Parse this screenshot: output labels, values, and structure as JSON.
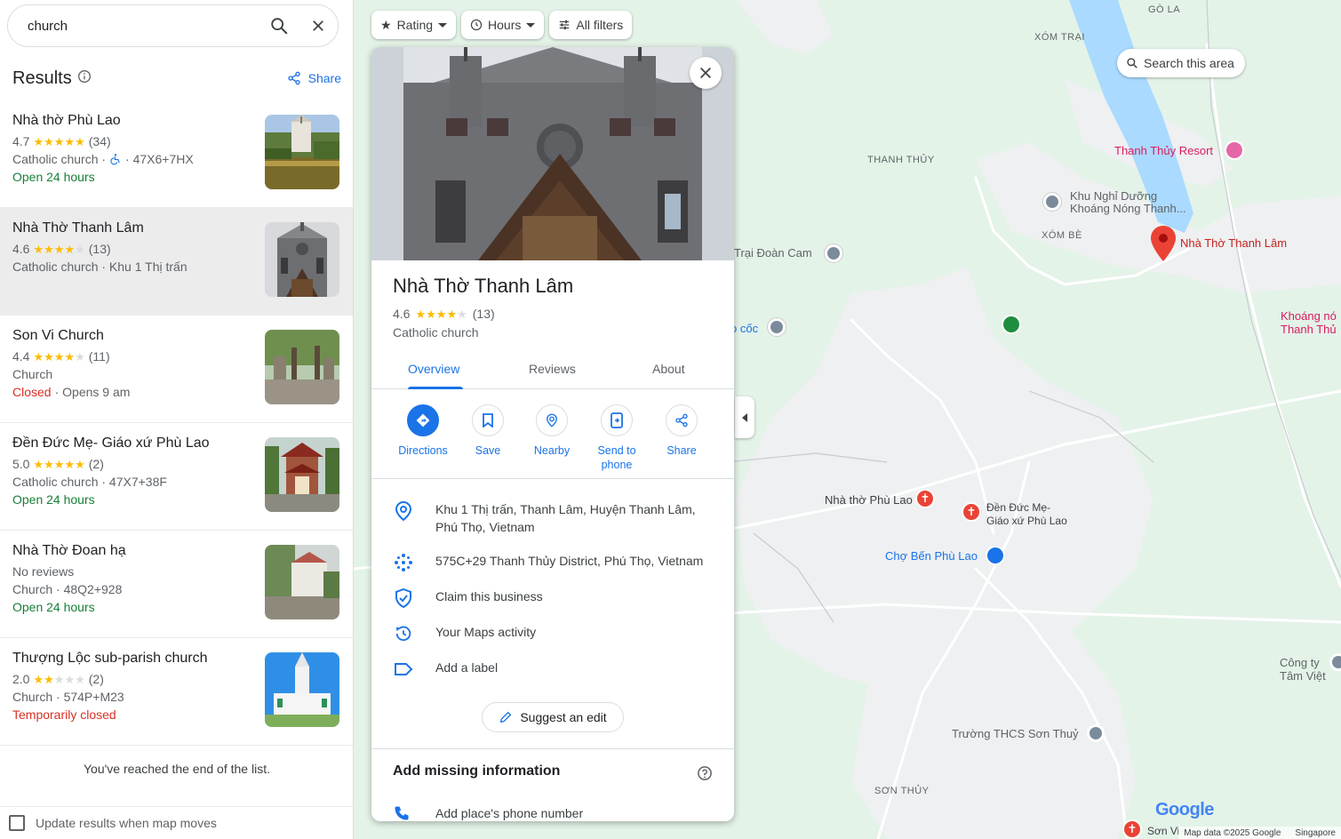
{
  "search": {
    "query": "church"
  },
  "results": {
    "title": "Results",
    "share_label": "Share",
    "items": [
      {
        "name": "Nhà thờ Phù Lao",
        "rating": "4.7",
        "stars": 4.7,
        "reviews": "(34)",
        "line2": "Catholic church · ",
        "line2b": " · 47X6+7HX",
        "status": "Open 24 hours",
        "status_color": "#188038",
        "status_extra": ""
      },
      {
        "name": "Nhà Thờ Thanh Lâm",
        "rating": "4.6",
        "stars": 4.6,
        "reviews": "(13)",
        "line2": "Catholic church · Khu 1 Thị trấn",
        "line2b": "",
        "status": "",
        "status_color": "",
        "status_extra": ""
      },
      {
        "name": "Son Vi Church",
        "rating": "4.4",
        "stars": 4.4,
        "reviews": "(11)",
        "line2": "Church",
        "line2b": "",
        "status": "Closed",
        "status_color": "#d93025",
        "status_extra": " · Opens 9 am"
      },
      {
        "name": "Đền Đức Mẹ- Giáo xứ Phù Lao",
        "rating": "5.0",
        "stars": 5.0,
        "reviews": "(2)",
        "line2": "Catholic church · 47X7+38F",
        "line2b": "",
        "status": "Open 24 hours",
        "status_color": "#188038",
        "status_extra": ""
      },
      {
        "name": "Nhà Thờ Đoan hạ",
        "rating": "No reviews",
        "stars": 0,
        "reviews": "",
        "line2": "Church · 48Q2+928",
        "line2b": "",
        "status": "Open 24 hours",
        "status_color": "#188038",
        "status_extra": ""
      },
      {
        "name": "Thượng Lộc sub-parish church",
        "rating": "2.0",
        "stars": 2.0,
        "reviews": "(2)",
        "line2": "Church · 574P+M23",
        "line2b": "",
        "status": "Temporarily closed",
        "status_color": "#d93025",
        "status_extra": ""
      }
    ],
    "end_text": "You've reached the end of the list.",
    "update_label": "Update results when map moves"
  },
  "filters": {
    "rating": "Rating",
    "hours": "Hours",
    "all": "All filters"
  },
  "map": {
    "search_area": "Search this area",
    "labels": {
      "go_la": "GÒ LA",
      "xom_trai": "XÓM TRẠI",
      "thanh_thuy": "THANH THỦY",
      "xom_be": "XÓM BÈ",
      "son_thuy": "SƠN THỦY"
    },
    "pois": {
      "resort": "Thanh Thủy Resort",
      "khu_nghi_1": "Khu Nghỉ Dưỡng",
      "khu_nghi_2": "Khoáng Nóng Thanh...",
      "thanh_lam": "Nhà Thờ Thanh Lâm",
      "trai_doan": "Trại Đoàn Cam",
      "co_coc": "o cốc",
      "khoang_1": "Khoáng nó",
      "khoang_2": "Thanh Thủ",
      "phu_lao": "Nhà thờ Phù Lao",
      "den_1": "Đền Đức Mẹ-",
      "den_2": "Giáo xứ Phù Lao",
      "cho": "Chợ Bến Phù Lao",
      "cong_ty": "Công ty Tâm Việt",
      "truong": "Trường THCS Sơn Thuỷ",
      "son_vi": "Sơn Vi"
    },
    "attribution": "Map data ©2025 Google",
    "region": "Singapore",
    "logo": "Google"
  },
  "place": {
    "title": "Nhà Thờ Thanh Lâm",
    "rating": "4.6",
    "reviews": "(13)",
    "category": "Catholic church",
    "tabs": [
      "Overview",
      "Reviews",
      "About"
    ],
    "actions": [
      "Directions",
      "Save",
      "Nearby",
      "Send to phone",
      "Share"
    ],
    "address_1": "Khu 1 Thị trấn, Thanh Lâm, Huyện Thanh Lâm,",
    "address_2": "Phú Thọ, Vietnam",
    "plus_code": "575C+29 Thanh Thủy District, Phú Thọ, Vietnam",
    "claim": "Claim this business",
    "activity": "Your Maps activity",
    "label": "Add a label",
    "suggest": "Suggest an edit",
    "missing": "Add missing information",
    "phone": "Add place's phone number"
  },
  "colors": {
    "accent": "#1a73e8",
    "open": "#188038",
    "closed": "#d93025",
    "star": "#fbbc04",
    "pin": "#ea4335",
    "water": "#aadaff"
  }
}
